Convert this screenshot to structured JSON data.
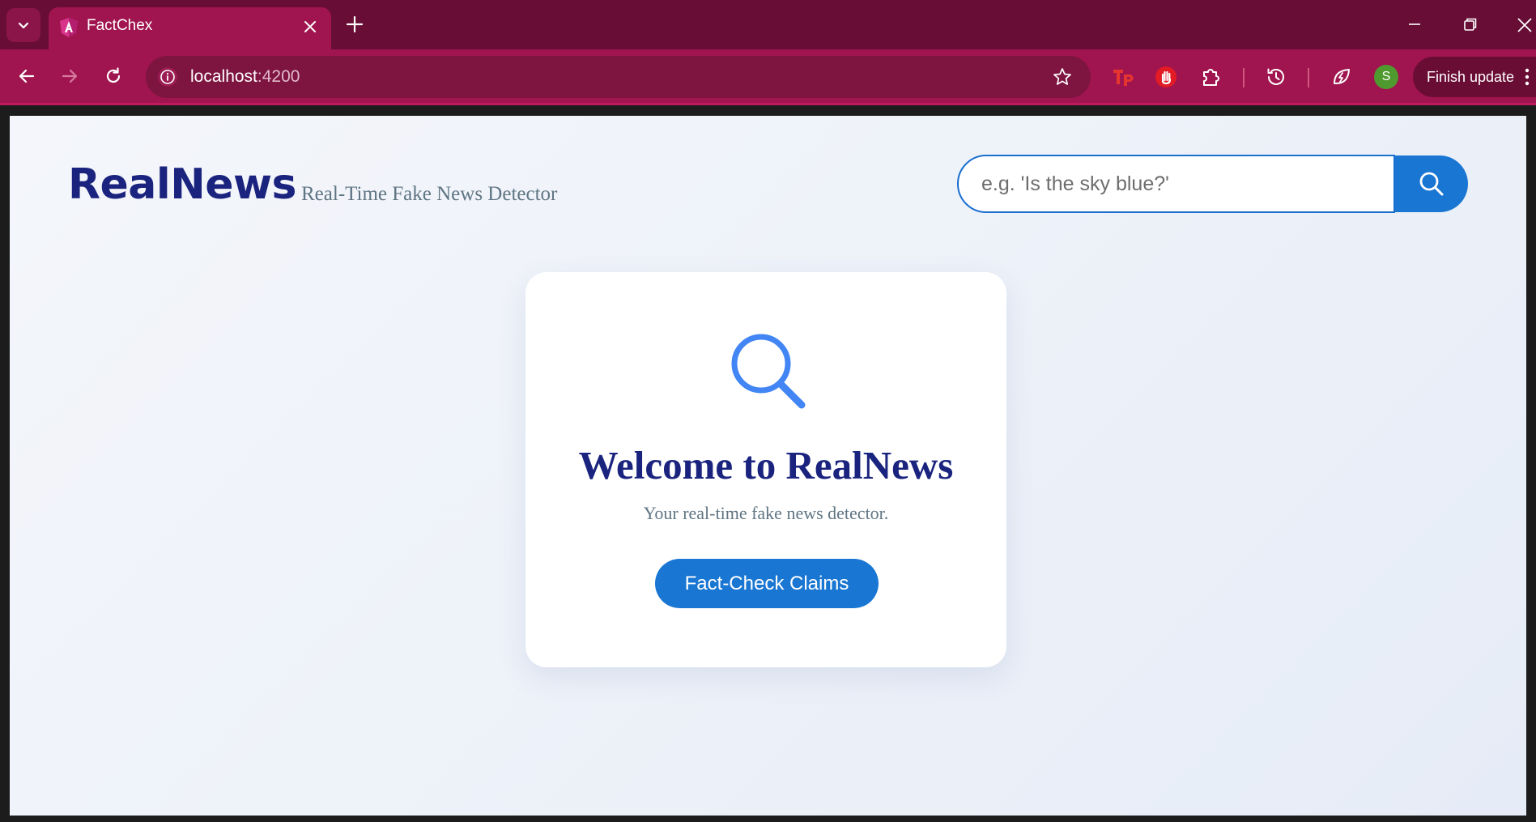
{
  "browser": {
    "tab": {
      "title": "FactChex"
    },
    "address_bar": {
      "host": "localhost",
      "port": ":4200"
    },
    "profile_initial": "S",
    "finish_update_label": "Finish update"
  },
  "site": {
    "brand": "RealNews",
    "tagline": "Real-Time Fake News Detector",
    "search": {
      "placeholder": "e.g. 'Is the sky blue?'"
    }
  },
  "welcome_card": {
    "title": "Welcome to RealNews",
    "subtitle": "Your real-time fake news detector.",
    "cta_label": "Fact-Check Claims"
  },
  "colors": {
    "chrome_dark": "#680d36",
    "chrome_tab": "#a0154f",
    "brand_navy": "#1a237e",
    "accent_blue": "#1976d2",
    "muted_text": "#5f7583"
  }
}
